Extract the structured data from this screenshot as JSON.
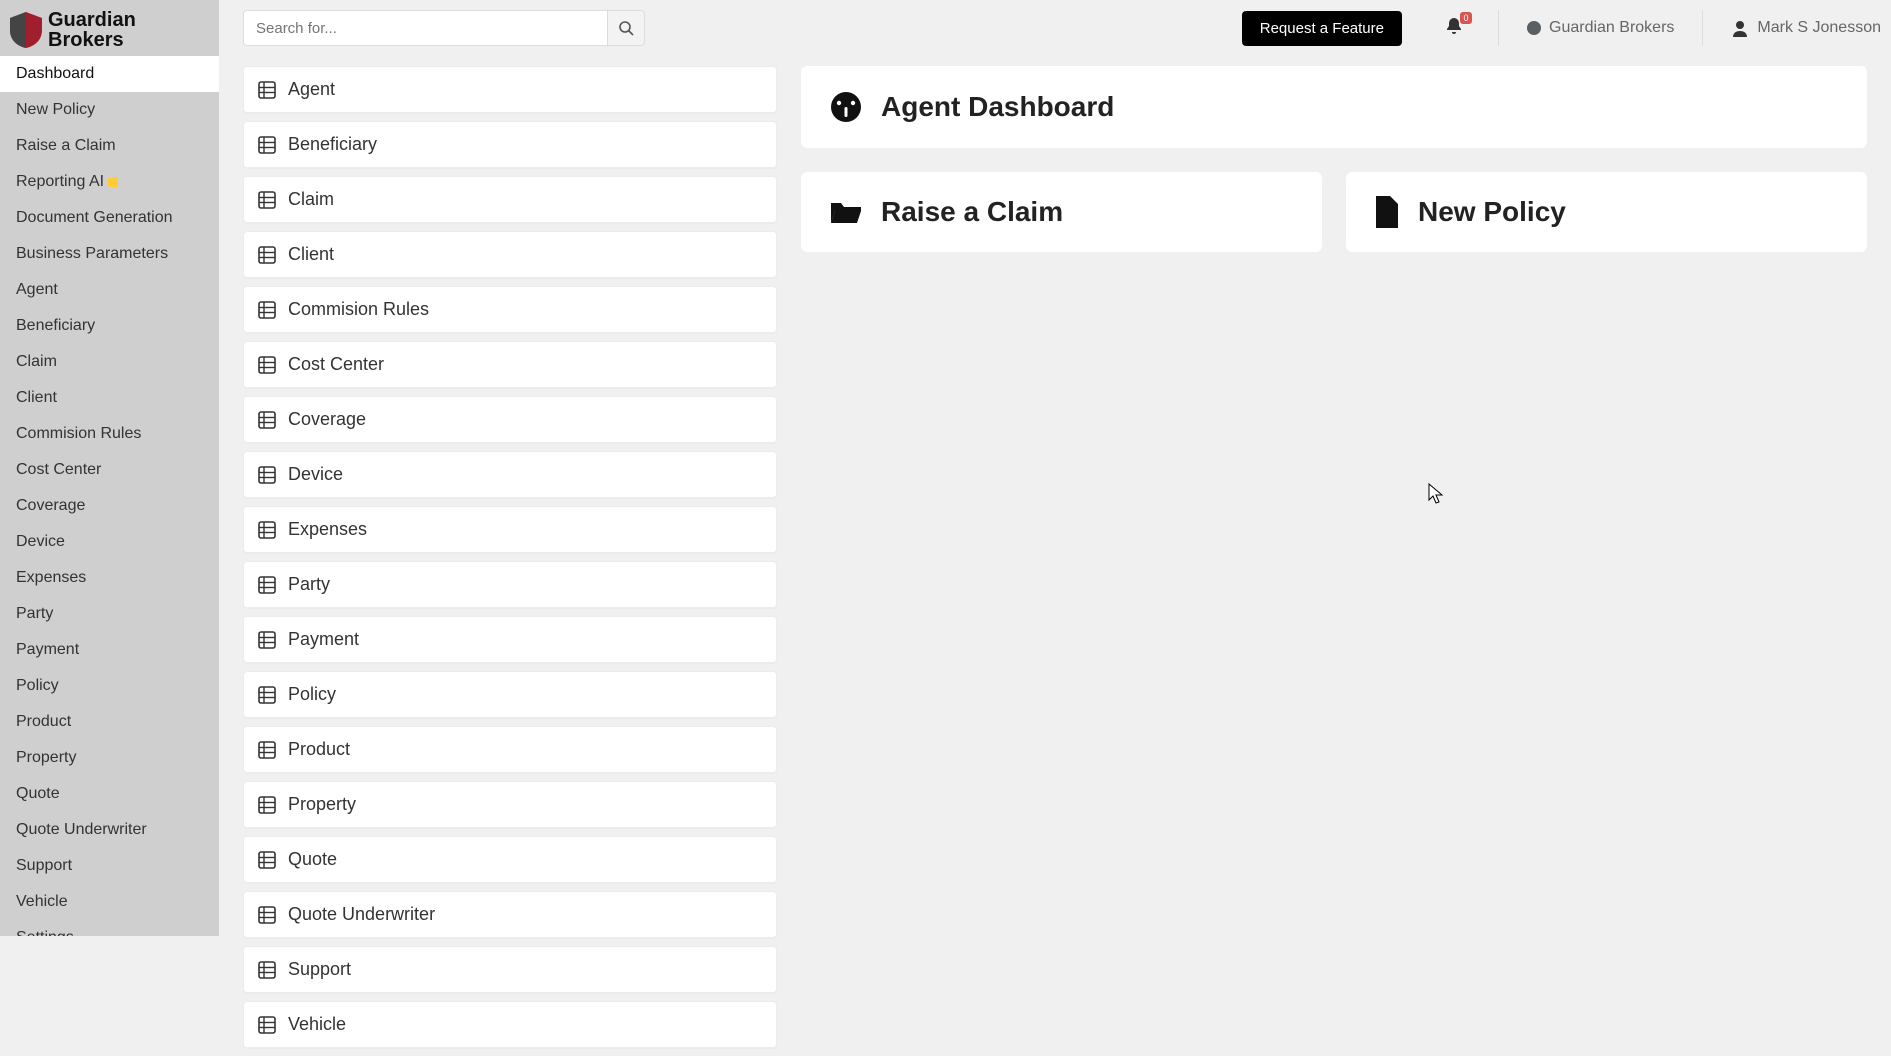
{
  "brand": {
    "name_line1": "Guardian",
    "name_line2": "Brokers"
  },
  "topbar": {
    "search_placeholder": "Search for...",
    "request_feature_label": "Request a Feature",
    "notification_count": "0",
    "org_name": "Guardian Brokers",
    "user_name": "Mark S Jonesson"
  },
  "sidebar": {
    "items": [
      {
        "label": "Dashboard",
        "active": true
      },
      {
        "label": "New Policy"
      },
      {
        "label": "Raise a Claim"
      },
      {
        "label": "Reporting AI",
        "badge": true
      },
      {
        "label": "Document Generation"
      },
      {
        "label": "Business Parameters"
      },
      {
        "label": "Agent"
      },
      {
        "label": "Beneficiary"
      },
      {
        "label": "Claim"
      },
      {
        "label": "Client"
      },
      {
        "label": "Commision Rules"
      },
      {
        "label": "Cost Center"
      },
      {
        "label": "Coverage"
      },
      {
        "label": "Device"
      },
      {
        "label": "Expenses"
      },
      {
        "label": "Party"
      },
      {
        "label": "Payment"
      },
      {
        "label": "Policy"
      },
      {
        "label": "Product"
      },
      {
        "label": "Property"
      },
      {
        "label": "Quote"
      },
      {
        "label": "Quote Underwriter"
      },
      {
        "label": "Support"
      },
      {
        "label": "Vehicle"
      },
      {
        "label": "Settings"
      }
    ]
  },
  "module_list": [
    "Agent",
    "Beneficiary",
    "Claim",
    "Client",
    "Commision Rules",
    "Cost Center",
    "Coverage",
    "Device",
    "Expenses",
    "Party",
    "Payment",
    "Policy",
    "Product",
    "Property",
    "Quote",
    "Quote Underwriter",
    "Support",
    "Vehicle"
  ],
  "cards": {
    "dashboard_title": "Agent Dashboard",
    "raise_claim": "Raise a Claim",
    "new_policy": "New Policy"
  }
}
